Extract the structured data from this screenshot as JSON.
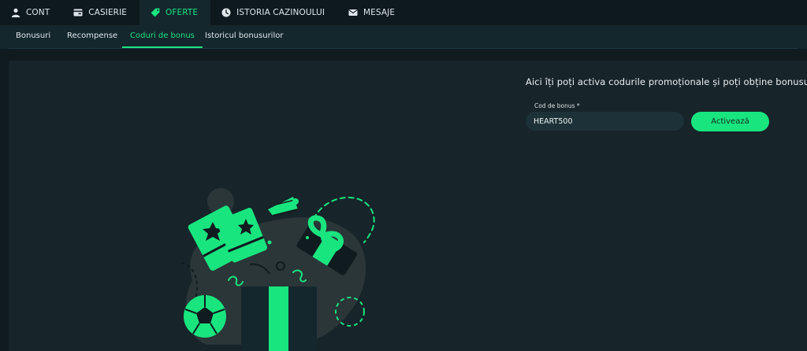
{
  "top_nav": {
    "tabs": [
      {
        "label": "CONT",
        "icon": "user-icon"
      },
      {
        "label": "CASIERIE",
        "icon": "wallet-icon"
      },
      {
        "label": "OFERTE",
        "icon": "tag-icon",
        "active": true
      },
      {
        "label": "ISTORIA CAZINOULUI",
        "icon": "clock-icon"
      },
      {
        "label": "MESAJE",
        "icon": "envelope-icon"
      }
    ]
  },
  "sub_nav": {
    "tabs": [
      {
        "label": "Bonusuri"
      },
      {
        "label": "Recompense"
      },
      {
        "label": "Coduri de bonus",
        "active": true
      },
      {
        "label": "Istoricul bonusurilor"
      }
    ]
  },
  "promo": {
    "heading": "Aici îți poți activa codurile promoționale și poți obține bonusurile.",
    "field_label": "Cod de bonus *",
    "code_value": "HEART500",
    "activate_label": "Activează"
  },
  "colors": {
    "accent": "#19e57f",
    "background": "#0f1b1f",
    "panel": "#17242a",
    "nav_active": "#14272d"
  }
}
